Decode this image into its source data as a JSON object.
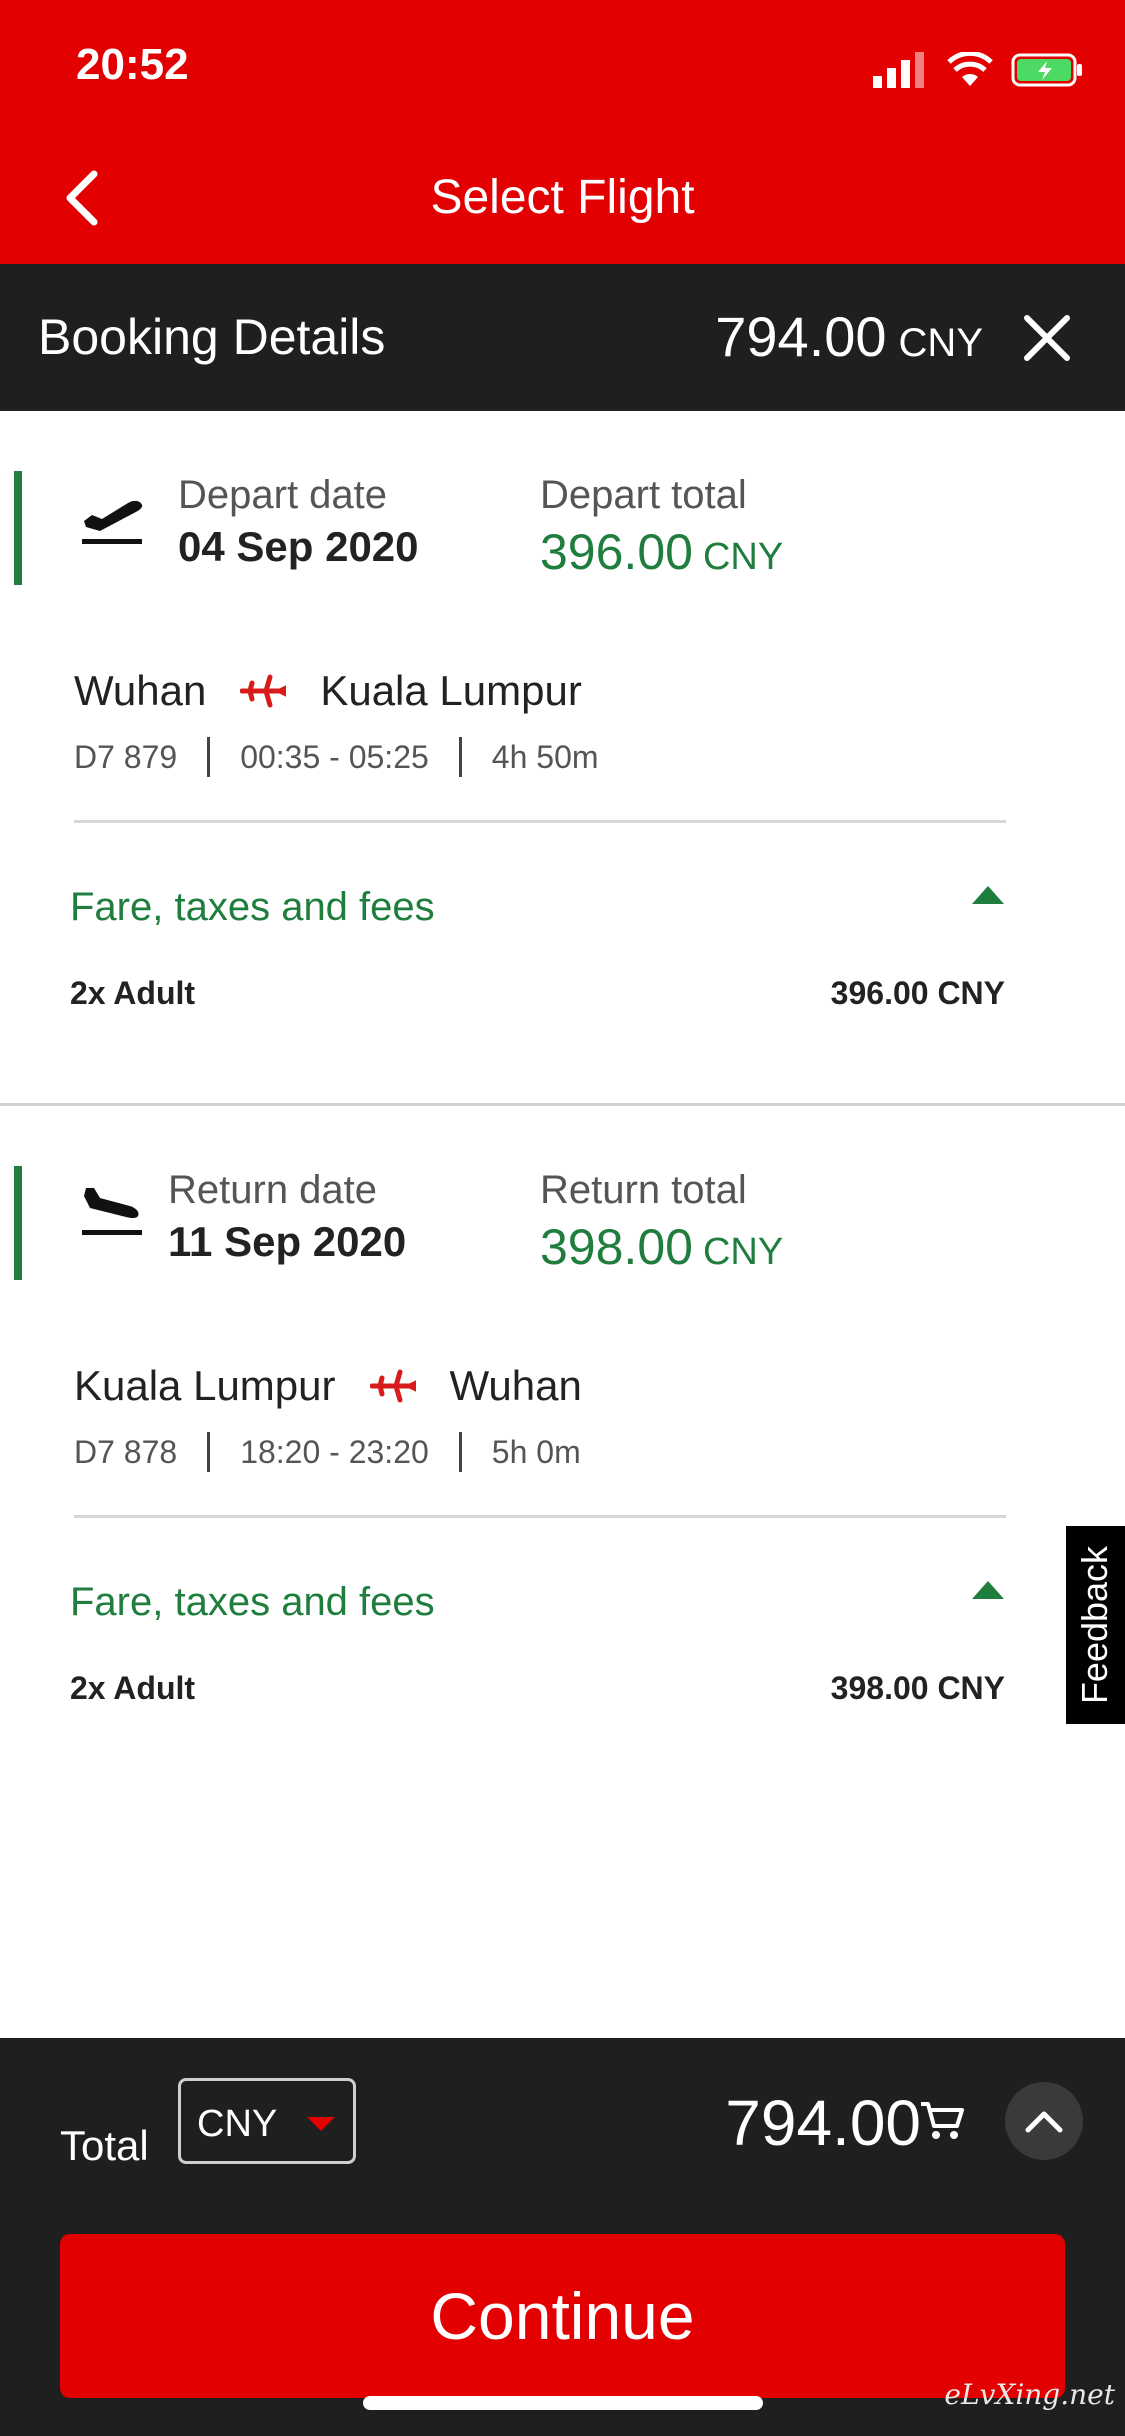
{
  "status_bar": {
    "time": "20:52"
  },
  "header": {
    "title": "Select Flight"
  },
  "booking_details": {
    "label": "Booking Details",
    "amount": "794.00",
    "currency": "CNY"
  },
  "depart": {
    "date_label": "Depart date",
    "date_value": "04 Sep 2020",
    "total_label": "Depart total",
    "total_value": "396.00",
    "currency": "CNY",
    "origin": "Wuhan",
    "destination": "Kuala Lumpur",
    "flight_no": "D7 879",
    "time_range": "00:35 - 05:25",
    "duration": "4h 50m",
    "fare_title": "Fare, taxes and fees",
    "passengers": "2x Adult",
    "fare_amount": "396.00 CNY"
  },
  "return": {
    "date_label": "Return date",
    "date_value": "11 Sep 2020",
    "total_label": "Return total",
    "total_value": "398.00",
    "currency": "CNY",
    "origin": "Kuala Lumpur",
    "destination": "Wuhan",
    "flight_no": "D7 878",
    "time_range": "18:20 - 23:20",
    "duration": "5h 0m",
    "fare_title": "Fare, taxes and fees",
    "passengers": "2x Adult",
    "fare_amount": "398.00 CNY"
  },
  "feedback": {
    "label": "Feedback"
  },
  "bottom_bar": {
    "total_label": "Total",
    "currency_selected": "CNY",
    "amount": "794.00",
    "continue_label": "Continue"
  },
  "watermark": "eLvXing.net",
  "colors": {
    "brand_red": "#e30000",
    "accent_green": "#1f7d3d",
    "dark_bar": "#1f1f1f"
  }
}
